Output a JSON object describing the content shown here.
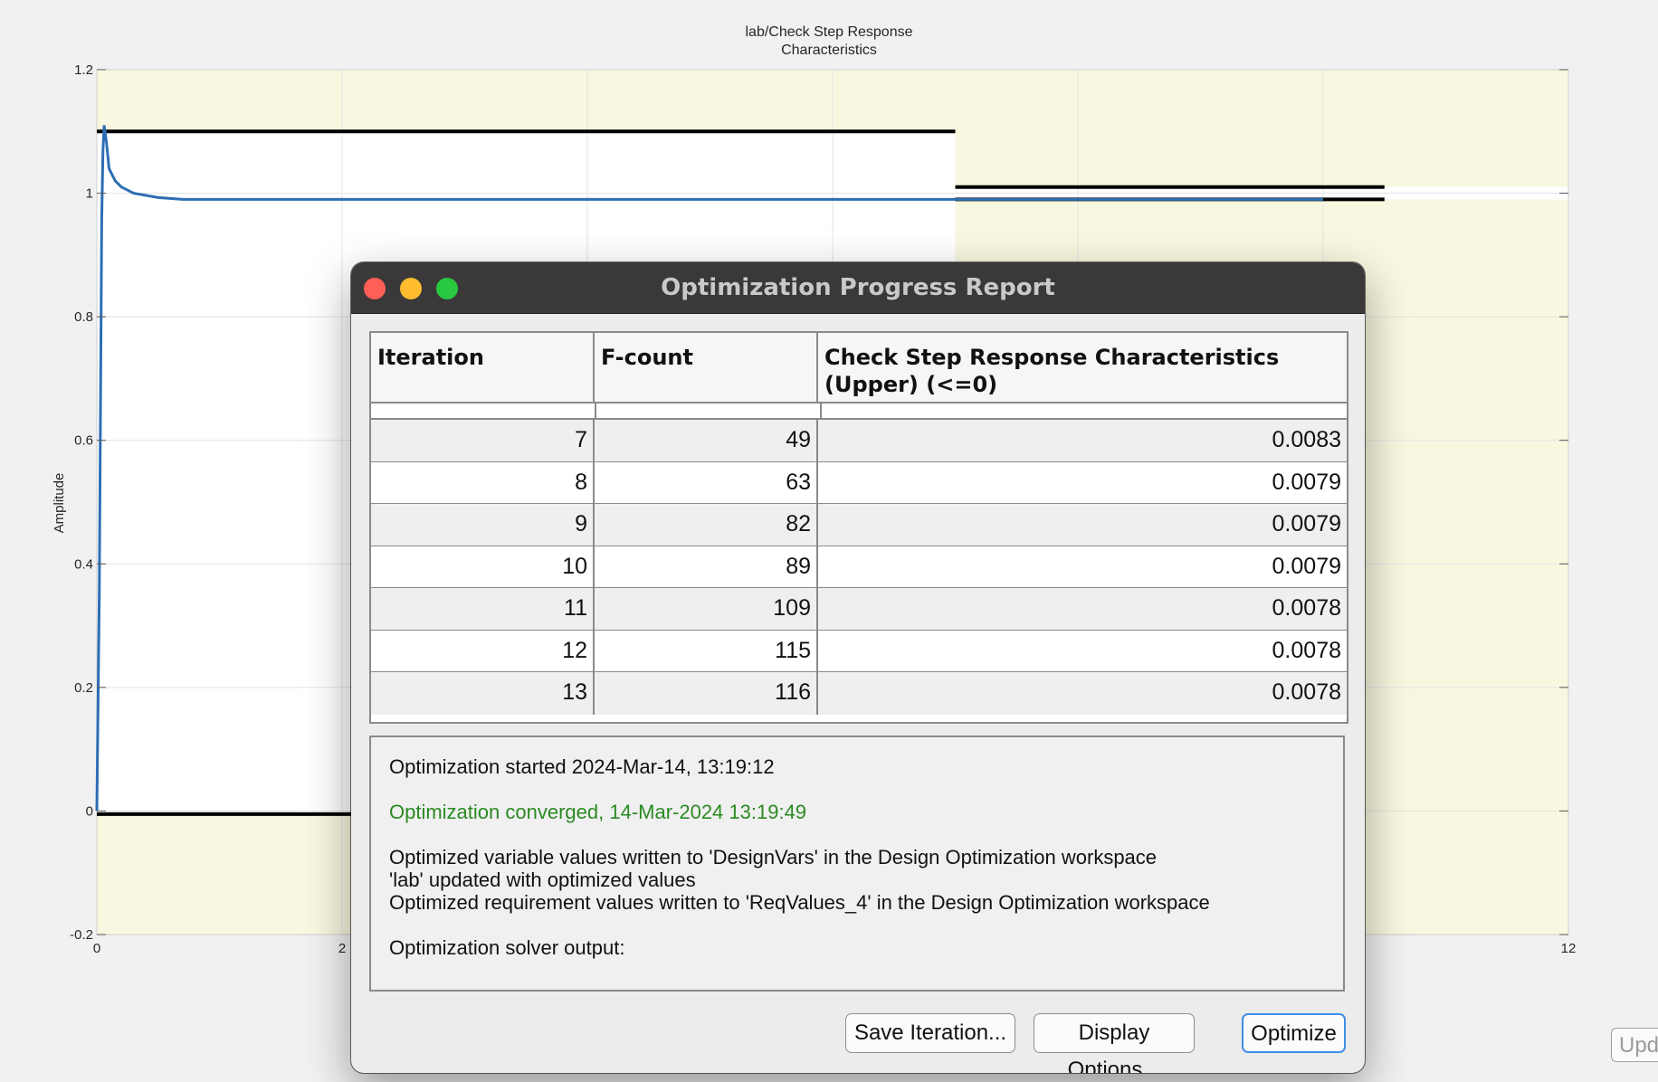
{
  "plot": {
    "title_line1": "lab/Check Step Response",
    "title_line2": "Characteristics",
    "ylabel": "Amplitude",
    "y_ticks": [
      "1.2",
      "1",
      "0.8",
      "0.6",
      "0.4",
      "0.2",
      "0",
      "-0.2"
    ],
    "x_ticks": [
      "0",
      "2",
      "12"
    ]
  },
  "chart_data": {
    "type": "line",
    "title": "lab/Check Step Response Characteristics",
    "xlabel": "",
    "ylabel": "Amplitude",
    "xlim": [
      0,
      12
    ],
    "ylim": [
      -0.2,
      1.2
    ],
    "grid": true,
    "series": [
      {
        "x": [
          0,
          0.02,
          0.04,
          0.05,
          0.06,
          0.08,
          0.1,
          0.15,
          0.2,
          0.3,
          0.5,
          0.7,
          1.0,
          2.0,
          4.0,
          8.0,
          10.0
        ],
        "y": [
          0,
          0.35,
          0.96,
          1.07,
          1.11,
          1.08,
          1.04,
          1.02,
          1.01,
          1.0,
          0.993,
          0.99,
          0.99,
          0.99,
          0.99,
          0.99,
          0.99
        ]
      }
    ],
    "bounds": {
      "upper": [
        {
          "x": [
            0,
            7
          ],
          "y": 1.1
        },
        {
          "x": [
            7,
            10.5
          ],
          "y": 1.01
        }
      ],
      "lower": [
        {
          "x": [
            0,
            2.1
          ],
          "y": -0.005
        },
        {
          "x": [
            7,
            10.5
          ],
          "y": 0.99
        }
      ]
    },
    "colors": {
      "response": "#2e6db4",
      "bound": "#000000",
      "infeasible": "#f8f8e0"
    }
  },
  "dialog": {
    "title": "Optimization Progress Report",
    "columns": [
      "Iteration",
      "F-count",
      "Check Step Response Characteristics (Upper) (<=0)"
    ],
    "rows": [
      [
        "7",
        "49",
        "0.0083"
      ],
      [
        "8",
        "63",
        "0.0079"
      ],
      [
        "9",
        "82",
        "0.0079"
      ],
      [
        "10",
        "89",
        "0.0079"
      ],
      [
        "11",
        "109",
        "0.0078"
      ],
      [
        "12",
        "115",
        "0.0078"
      ],
      [
        "13",
        "116",
        "0.0078"
      ]
    ],
    "log": {
      "started": "Optimization started 2024-Mar-14, 13:19:12",
      "converged": "Optimization converged, 14-Mar-2024 13:19:49",
      "line1": "Optimized variable values written to 'DesignVars' in the Design Optimization workspace",
      "line2": "'lab' updated with optimized values",
      "line3": "Optimized requirement values written to 'ReqValues_4' in the Design Optimization workspace",
      "solver": "Optimization solver output:"
    },
    "buttons": {
      "save": "Save Iteration...",
      "display": "Display Options...",
      "optimize": "Optimize"
    }
  },
  "stub_button": "Upd"
}
